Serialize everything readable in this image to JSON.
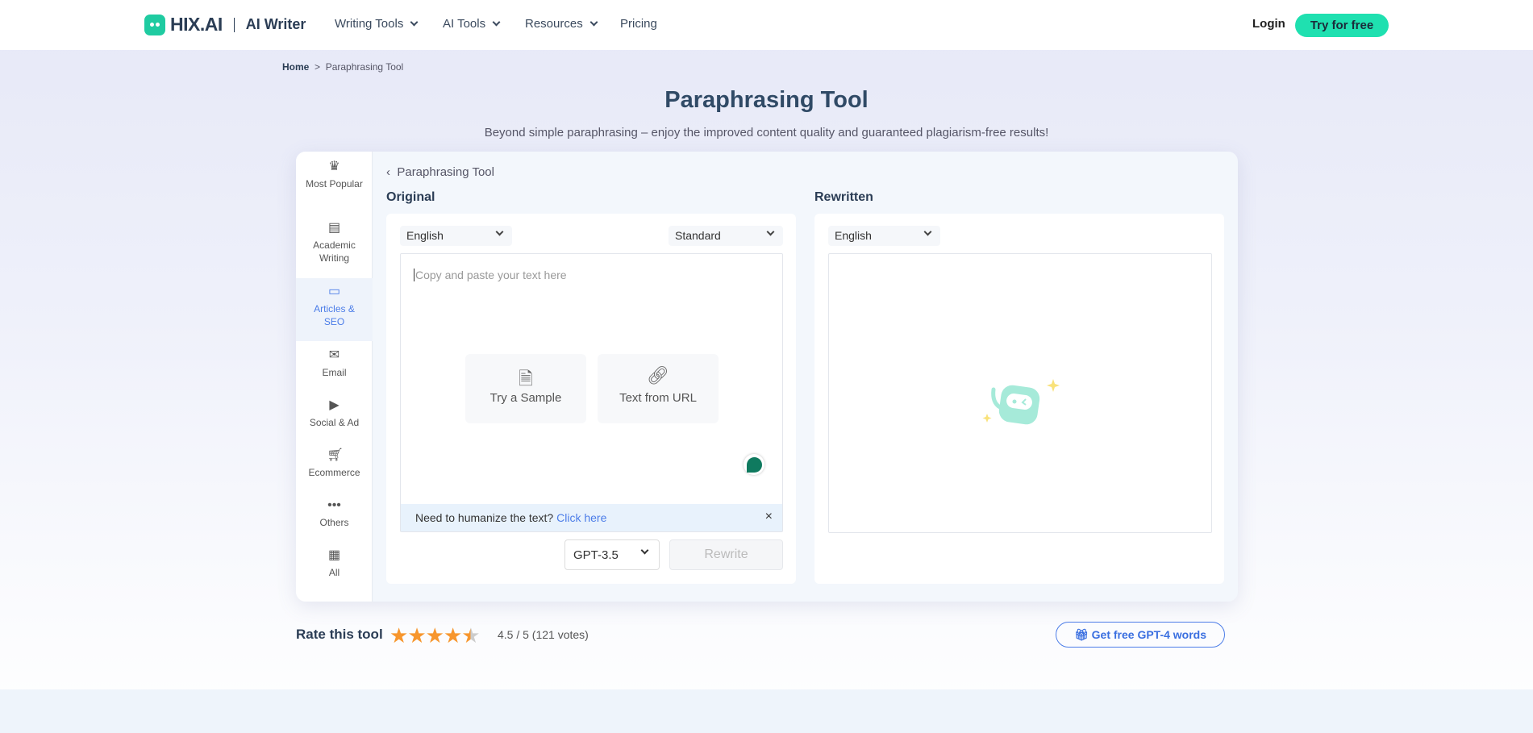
{
  "header": {
    "logo": "HIX.AI",
    "product": "AI Writer",
    "nav": [
      "Writing Tools",
      "AI Tools",
      "Resources",
      "Pricing"
    ],
    "login": "Login",
    "try_free": "Try for free"
  },
  "breadcrumb": {
    "home": "Home",
    "sep": ">",
    "current": "Paraphrasing Tool"
  },
  "page": {
    "title": "Paraphrasing Tool",
    "subtitle": "Beyond simple paraphrasing – enjoy the improved content quality and guaranteed plagiarism-free results!"
  },
  "sidebar": {
    "items": [
      {
        "label": "Most Popular",
        "icon": "crown-icon"
      },
      {
        "label": "Academic Writing",
        "icon": "newspaper-icon"
      },
      {
        "label": "Articles & SEO",
        "icon": "browser-icon",
        "active": true
      },
      {
        "label": "Email",
        "icon": "mail-icon"
      },
      {
        "label": "Social & Ad",
        "icon": "presentation-icon"
      },
      {
        "label": "Ecommerce",
        "icon": "cart-icon"
      },
      {
        "label": "Others",
        "icon": "dots-icon"
      },
      {
        "label": "All",
        "icon": "grid-icon"
      }
    ]
  },
  "tool": {
    "back_label": "Paraphrasing Tool",
    "original": {
      "label": "Original",
      "language": "English",
      "mode": "Standard",
      "placeholder": "Copy and paste your text here",
      "try_sample": "Try a Sample",
      "text_from_url": "Text from URL",
      "humanize_text": "Need to humanize the text?",
      "humanize_link": "Click here",
      "close": "×",
      "model": "GPT-3.5",
      "rewrite": "Rewrite"
    },
    "rewritten": {
      "label": "Rewritten",
      "language": "English"
    }
  },
  "rating": {
    "label": "Rate this tool",
    "value": 4.5,
    "max": 5,
    "text": "4.5 / 5 (121 votes)",
    "star_color": "#f7962d"
  },
  "promo": {
    "label": "Get free GPT-4 words"
  },
  "colors": {
    "brand": "#1fcba1",
    "cta": "#1fe0b0",
    "accent": "#4c7de8"
  }
}
